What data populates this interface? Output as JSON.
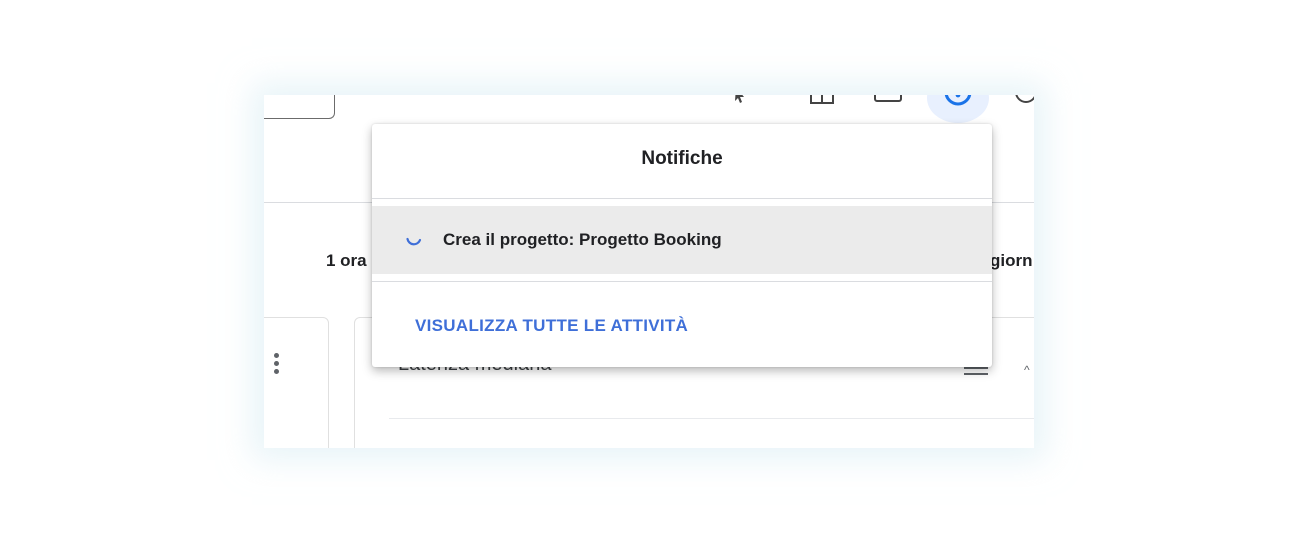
{
  "background": {
    "time_left": "1 ora",
    "time_right": "giorn",
    "card_title": "Latenza mediana"
  },
  "icons": {
    "toolbar": [
      "cursor-icon",
      "grid-icon",
      "terminal-icon",
      "notifications-icon",
      "help-icon"
    ],
    "row": [
      "loading-spinner-icon"
    ],
    "card": [
      "more-vert-icon",
      "list-icon",
      "chevron-icon"
    ]
  },
  "colors": {
    "link": "#3f6fd8",
    "row_highlight": "#ebebeb",
    "active_icon_bg": "#e8f0fe"
  },
  "notifications": {
    "title": "Notifiche",
    "items": [
      {
        "text": "Crea il progetto: Progetto Booking",
        "status": "in-progress"
      }
    ],
    "view_all_label": "VISUALIZZA TUTTE LE ATTIVITÀ"
  }
}
